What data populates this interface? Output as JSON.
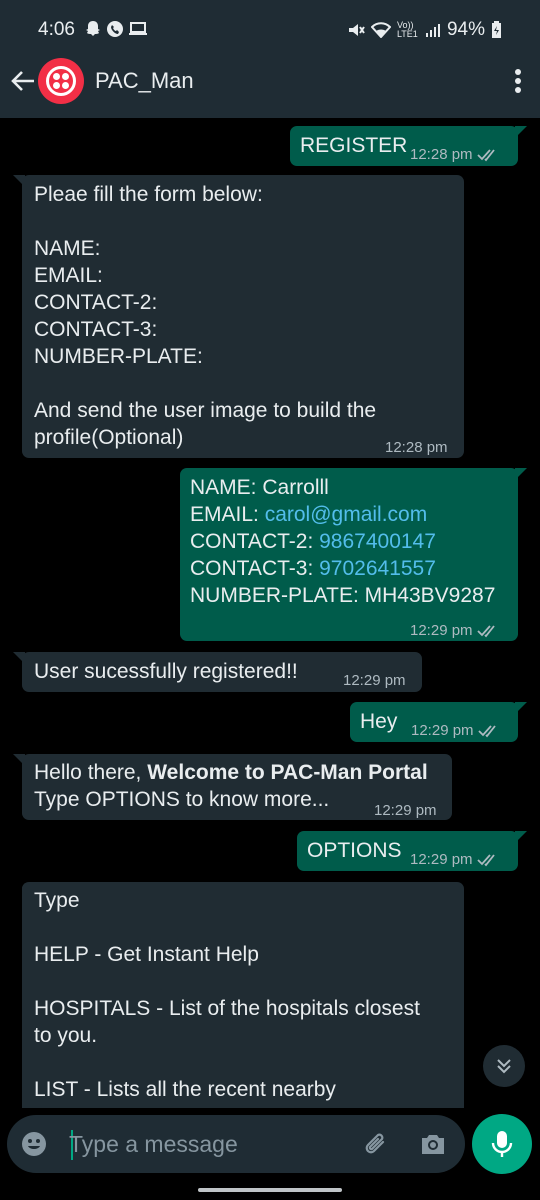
{
  "status_bar": {
    "time": "4:06",
    "network": "Vo)) LTE1",
    "battery": "94%"
  },
  "header": {
    "contact_name": "PAC_Man",
    "avatar_color": "#f22f46"
  },
  "messages": [
    {
      "direction": "outgoing",
      "text": "REGISTER",
      "time": "12:28 pm",
      "read": true
    },
    {
      "direction": "incoming",
      "text": "Pleae fill the form below:\n\nNAME:\nEMAIL:\nCONTACT-2:\nCONTACT-3:\nNUMBER-PLATE:\n\nAnd send the user image to build the\nprofile(Optional)",
      "time": "12:28 pm"
    },
    {
      "direction": "outgoing",
      "lines": {
        "name_label": "NAME: ",
        "name_value": "Carrolll",
        "email_label": "EMAIL: ",
        "email_value": "carol@gmail.com",
        "contact2_label": "CONTACT-2: ",
        "contact2_value": "9867400147",
        "contact3_label": "CONTACT-3: ",
        "contact3_value": "9702641557",
        "plate_label": "NUMBER-PLATE: ",
        "plate_value": "MH43BV9287"
      },
      "time": "12:29 pm",
      "read": true
    },
    {
      "direction": "incoming",
      "text": "User sucessfully registered!!",
      "time": "12:29 pm"
    },
    {
      "direction": "outgoing",
      "text": "Hey",
      "time": "12:29 pm",
      "read": true
    },
    {
      "direction": "incoming",
      "line1_plain": "Hello there, ",
      "line1_bold": "Welcome to PAC-Man Portal",
      "line2": "Type OPTIONS to know more...",
      "time": "12:29 pm"
    },
    {
      "direction": "outgoing",
      "text": "OPTIONS",
      "time": "12:29 pm",
      "read": true
    },
    {
      "direction": "incoming",
      "text": "Type\n\nHELP - Get Instant Help\n\nHOSPITALS - List of the hospitals closest\nto you.\n\nLIST - Lists all the recent nearby"
    }
  ],
  "composer": {
    "placeholder": "Type a message"
  },
  "colors": {
    "outgoing_bubble": "#005c4b",
    "incoming_bubble": "#202c33",
    "accent": "#00a884",
    "link": "#53bdeb"
  }
}
